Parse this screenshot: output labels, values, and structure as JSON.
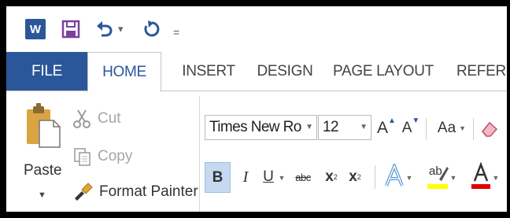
{
  "quick_access": {
    "app_logo_letter": "W",
    "icons": [
      "word-logo-icon",
      "save-icon",
      "undo-icon",
      "redo-icon",
      "customize-qat-icon"
    ],
    "undo_dropdown": "▾",
    "customize": "="
  },
  "tabs": [
    {
      "label": "FILE"
    },
    {
      "label": "HOME"
    },
    {
      "label": "INSERT"
    },
    {
      "label": "DESIGN"
    },
    {
      "label": "PAGE LAYOUT"
    },
    {
      "label": "REFERE"
    }
  ],
  "clipboard": {
    "paste_label": "Paste",
    "cut_label": "Cut",
    "copy_label": "Copy",
    "format_painter_label": "Format Painter"
  },
  "font": {
    "font_name": "Times New Ro",
    "font_size": "12",
    "change_case_label": "Aa",
    "bold_label": "B",
    "italic_label": "I",
    "underline_label": "U",
    "strikethrough_label": "abc",
    "subscript_label": "x",
    "subscript_mark": "2",
    "superscript_label": "x",
    "superscript_mark": "2",
    "grow_font_label": "A",
    "shrink_font_label": "A"
  },
  "colors": {
    "accent": "#2b579a",
    "bold_active_bg": "#c5d9f1",
    "highlight_color": "#ffff00",
    "font_color": "#e00000"
  }
}
